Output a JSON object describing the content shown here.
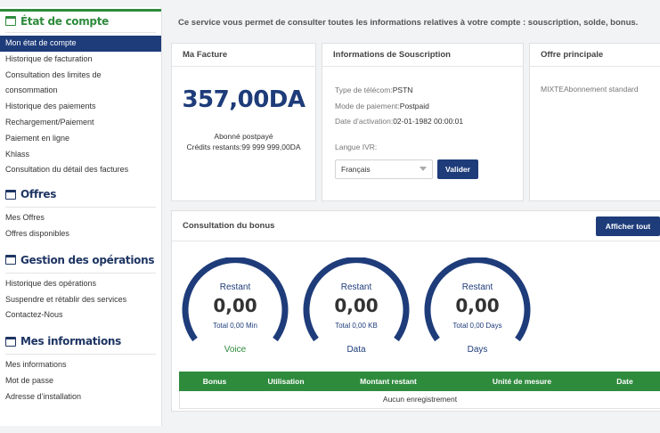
{
  "sidebar": {
    "sections": [
      {
        "title": "État de compte",
        "items": [
          "Mon état de compte",
          "Historique de facturation",
          "Consultation des limites de",
          "consommation",
          "Historique des paiements",
          "Rechargement/Paiement",
          "Paiement en ligne",
          "Khlass",
          "Consultation du détail des factures"
        ]
      },
      {
        "title": "Offres",
        "items": [
          "Mes Offres",
          "Offres disponibles"
        ]
      },
      {
        "title": "Gestion des opérations",
        "items": [
          "Historique des opérations",
          "Suspendre et rétablir des services",
          "Contactez-Nous"
        ]
      },
      {
        "title": "Mes informations",
        "items": [
          "Mes informations",
          "Mot de passe",
          "Adresse d’installation"
        ]
      }
    ]
  },
  "main": {
    "intro": "Ce service vous permet de consulter toutes les informations relatives à votre compte : souscription, solde, bonus.",
    "facture": {
      "title": "Ma Facture",
      "amount": "357,00DA",
      "status": "Abonné postpayé",
      "credits": "Crédits restants:99 999 999,00DA"
    },
    "souscription": {
      "title": "Informations de Souscription",
      "type_label": "Type de télécom:",
      "type_value": "PSTN",
      "mode_label": "Mode de paiement:",
      "mode_value": "Postpaid",
      "date_label": "Date d’activation:",
      "date_value": "02-01-1982 00:00:01",
      "langue_label": "Langue IVR:",
      "langue_selected": "Français",
      "valider": "Valider"
    },
    "offre": {
      "title": "Offre principale",
      "text": "MIXTEAbonnement standard"
    },
    "bonus": {
      "title": "Consultation du bonus",
      "button": "Afficher tout",
      "gauges": [
        {
          "restant": "Restant",
          "value": "0,00",
          "total": "Total 0,00 Min",
          "label": "Voice",
          "label_color": "#2e8b3c"
        },
        {
          "restant": "Restant",
          "value": "0,00",
          "total": "Total 0,00 KB",
          "label": "Data",
          "label_color": "#1e3c7a"
        },
        {
          "restant": "Restant",
          "value": "0,00",
          "total": "Total 0,00 Days",
          "label": "Days",
          "label_color": "#1e3c7a"
        }
      ],
      "table": {
        "columns": [
          "Bonus",
          "Utilisation",
          "Montant restant",
          "Unité de mesure",
          "Date"
        ],
        "empty": "Aucun enregistrement"
      }
    }
  },
  "colors": {
    "navy": "#1e3c7a",
    "green": "#2e8b3c"
  }
}
